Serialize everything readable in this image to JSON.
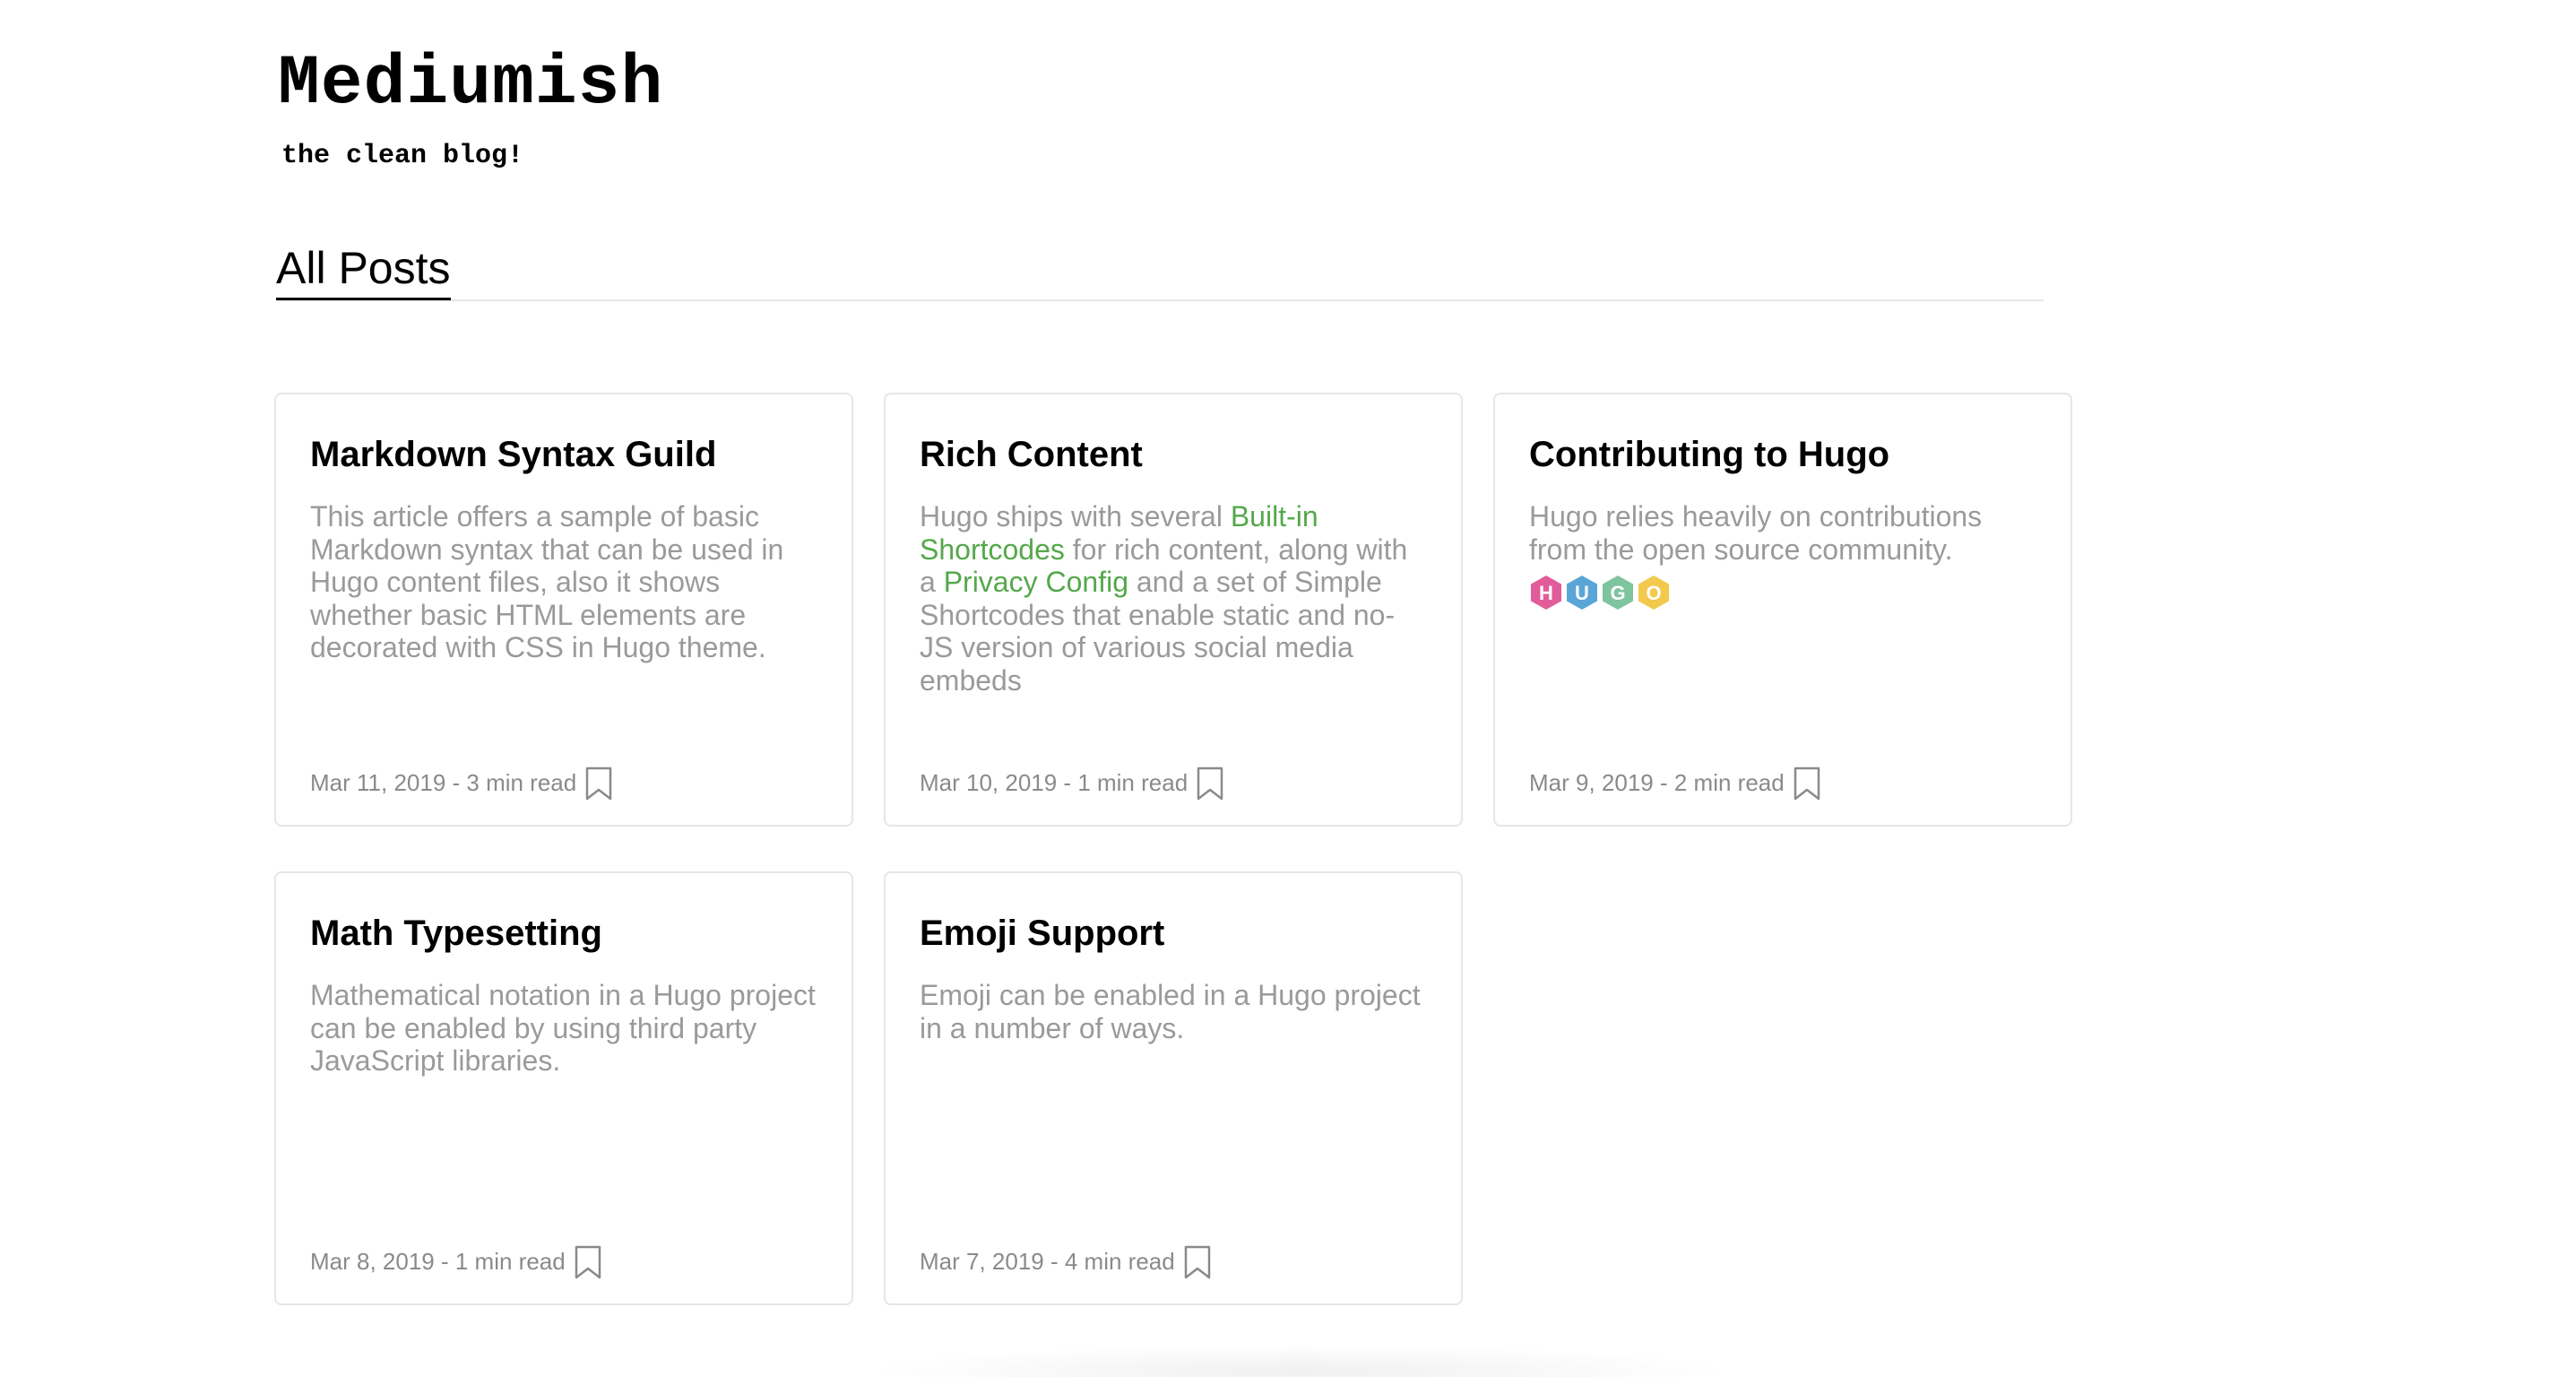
{
  "site": {
    "title": "Mediumish",
    "tagline": "the clean blog!"
  },
  "section": {
    "title": "All Posts"
  },
  "colors": {
    "link": "#54a84b",
    "excerpt": "#9a9a9a",
    "meta": "#8a8a8a",
    "card_border": "#e6e6e6"
  },
  "posts": [
    {
      "title": "Markdown Syntax Guild",
      "excerpt": "This article offers a sample of basic Markdown syntax that can be used in Hugo content files, also it shows whether basic HTML elements are decorated with CSS in Hugo theme.",
      "meta": "Mar 11, 2019 - 3 min read",
      "icon": "bookmark-icon"
    },
    {
      "title": "Rich Content",
      "excerpt_parts": [
        "Hugo ships with several ",
        "Built-in Shortcodes",
        " for rich content, along with a ",
        "Privacy Config",
        " and a set of Simple Shortcodes that enable static and no-JS version of various social media embeds"
      ],
      "meta": "Mar 10, 2019 - 1 min read",
      "icon": "bookmark-icon"
    },
    {
      "title": "Contributing to Hugo",
      "excerpt": "Hugo relies heavily on contributions from the open source community.",
      "badges": [
        {
          "letter": "H",
          "color": "#e25c99"
        },
        {
          "letter": "U",
          "color": "#5aa5d8"
        },
        {
          "letter": "G",
          "color": "#7ec49f"
        },
        {
          "letter": "O",
          "color": "#f2c94c"
        }
      ],
      "meta": "Mar 9, 2019 - 2 min read",
      "icon": "bookmark-icon"
    },
    {
      "title": "Math Typesetting",
      "excerpt": "Mathematical notation in a Hugo project can be enabled by using third party JavaScript libraries.",
      "meta": "Mar 8, 2019 - 1 min read",
      "icon": "bookmark-icon"
    },
    {
      "title": "Emoji Support",
      "excerpt": "Emoji can be enabled in a Hugo project in a number of ways.",
      "meta": "Mar 7, 2019 - 4 min read",
      "icon": "bookmark-icon"
    }
  ]
}
